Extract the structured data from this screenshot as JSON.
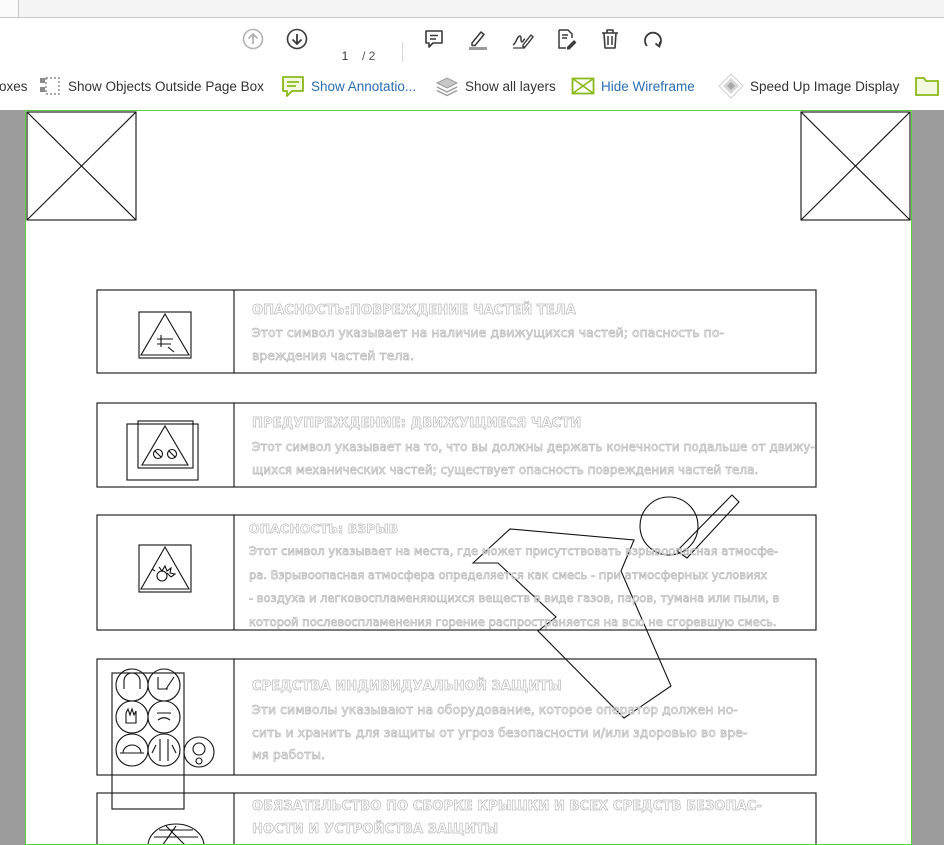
{
  "toolbar": {
    "page_current": "1",
    "page_total": "/ 2",
    "icons": [
      "arrow-up-icon",
      "arrow-down-icon",
      "comment-icon",
      "highlight-icon",
      "sign-icon",
      "edit-pdf-icon",
      "delete-icon",
      "rotate-icon"
    ]
  },
  "viewbar": {
    "partial_label": "oxes",
    "items": [
      {
        "label": "Show Objects Outside Page Box",
        "icon": "objects-outside-icon",
        "active": false
      },
      {
        "label": "Show Annotatio...",
        "icon": "annotation-icon",
        "active": true
      },
      {
        "label": "Show all layers",
        "icon": "layers-icon",
        "active": false
      },
      {
        "label": "Hide Wireframe",
        "icon": "wireframe-icon",
        "active": true
      },
      {
        "label": "Speed Up Image Display",
        "icon": "speed-image-icon",
        "active": false
      }
    ]
  },
  "colors": {
    "page_border": "#5ccf3c",
    "gutter": "#9c9c9c",
    "active_text": "#2a6db0",
    "annotation_icon": "#8bb81b"
  },
  "document": {
    "rows": [
      {
        "heading": "ОПАСНОСТЬ:ПОВРЕЖДЕНИЕ ЧАСТЕЙ ТЕЛА",
        "body": "Этот символ указывает на наличие движущихся частей; опасность по-\nвреждения частей тела."
      },
      {
        "heading": "ПРЕДУПРЕЖДЕНИЕ: ДВИЖУЩИЕСЯ ЧАСТИ",
        "body": "Этот символ указывает на то, что вы должны держать конечности подальше от движу-\nщихся механических частей; существует опасность повреждения частей тела."
      },
      {
        "heading": "ОПАСНОСТЬ: ВЗРЫВ",
        "body": "Этот символ указывает на места, где может присутствовать взрывоопасная атмосфе-\nра. Взрывоопасная атмосфера определяется как смесь - при атмосферных условиях\n- воздуха и легковоспламеняющихся веществ в виде газов, паров, тумана или пыли, в\nкоторой послевоспламенения горение распространяется на всю не сгоревшую смесь."
      },
      {
        "heading": "СРЕДСТВА ИНДИВИДУАЛЬНОЙ ЗАЩИТЫ",
        "body": "Эти символы указывают на оборудование, которое оператор должен но-\nсить и хранить для защиты от угроз безопасности и/или здоровью во вре-\nмя работы."
      },
      {
        "heading": "ОБЯЗАТЕЛЬСТВО ПО СБОРКЕ КРЫШКИ И ВСЕХ СРЕДСТВ БЕЗОПАС-\nНОСТИ И УСТРОЙСТВА ЗАЩИТЫ",
        "body": ""
      }
    ]
  }
}
